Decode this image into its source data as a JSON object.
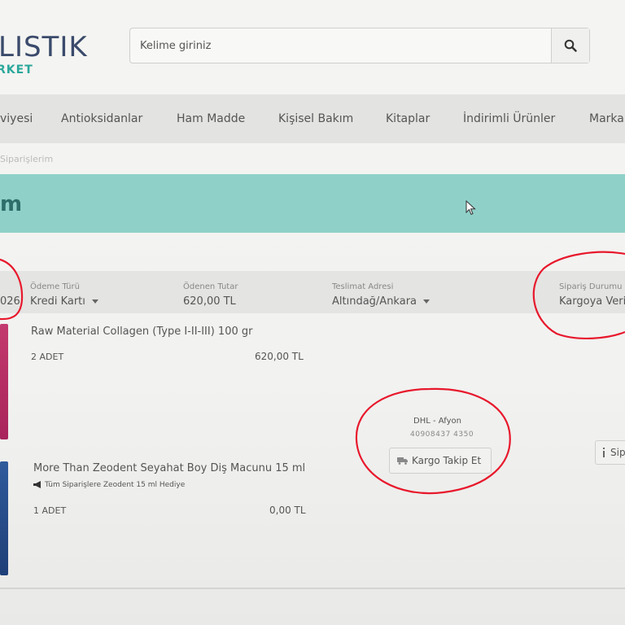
{
  "header": {
    "logo_main": "LISTIK",
    "logo_sub": "RKET",
    "search_placeholder": "Kelime giriniz",
    "search_icon": "search-icon"
  },
  "nav": {
    "items": [
      "viyesi",
      "Antioksidanlar",
      "Ham Madde",
      "Kişisel Bakım",
      "Kitaplar",
      "İndirimli Ürünler",
      "Marka"
    ]
  },
  "breadcrumb": "Siparişlerim",
  "page_title": "m",
  "order": {
    "id_fragment": "026",
    "payment_label": "Ödeme Türü",
    "payment_value": "Kredi Kartı",
    "paid_label": "Ödenen Tutar",
    "paid_value": "620,00 TL",
    "address_label": "Teslimat Adresi",
    "address_value": "Altındağ/Ankara",
    "status_label": "Sipariş Durumu",
    "status_value": "Kargoya Verildi"
  },
  "products": [
    {
      "name": "Raw Material Collagen (Type I-II-III) 100 gr",
      "qty": "2 ADET",
      "price": "620,00 TL"
    },
    {
      "name": "More Than Zeodent Seyahat Boy Diş Macunu 15 ml",
      "promo": "Tüm Siparişlere Zeodent 15 ml Hediye",
      "qty": "1 ADET",
      "price": "0,00 TL"
    }
  ],
  "shipping": {
    "carrier": "DHL - Afyon",
    "tracking_number": "40908437 4350",
    "track_button": "Kargo Takip Et",
    "truck_icon": "truck-icon",
    "order_button": "Sip",
    "info_icon": "info-icon"
  },
  "colors": {
    "accent_band": "#8fd1c9",
    "logo_blue": "#3a4a6b",
    "logo_teal": "#2aa79b",
    "annotation_red": "#e8182c"
  }
}
